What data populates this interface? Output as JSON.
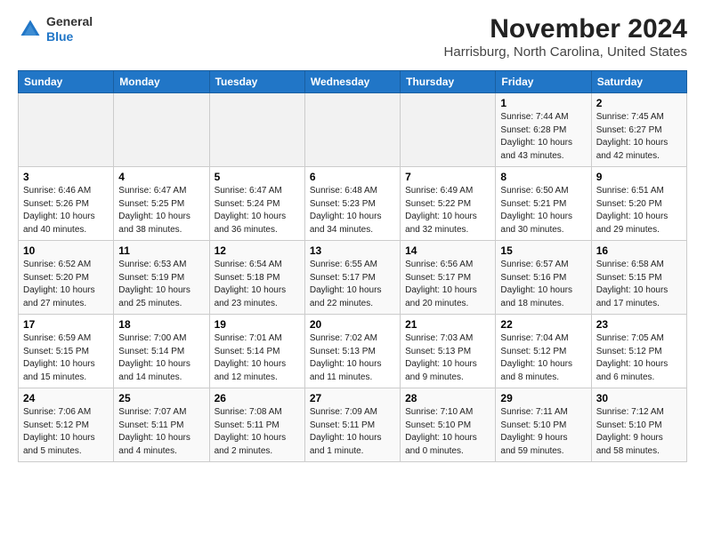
{
  "header": {
    "logo_line1": "General",
    "logo_line2": "Blue",
    "month_year": "November 2024",
    "location": "Harrisburg, North Carolina, United States"
  },
  "weekdays": [
    "Sunday",
    "Monday",
    "Tuesday",
    "Wednesday",
    "Thursday",
    "Friday",
    "Saturday"
  ],
  "weeks": [
    [
      {
        "day": "",
        "info": ""
      },
      {
        "day": "",
        "info": ""
      },
      {
        "day": "",
        "info": ""
      },
      {
        "day": "",
        "info": ""
      },
      {
        "day": "",
        "info": ""
      },
      {
        "day": "1",
        "info": "Sunrise: 7:44 AM\nSunset: 6:28 PM\nDaylight: 10 hours\nand 43 minutes."
      },
      {
        "day": "2",
        "info": "Sunrise: 7:45 AM\nSunset: 6:27 PM\nDaylight: 10 hours\nand 42 minutes."
      }
    ],
    [
      {
        "day": "3",
        "info": "Sunrise: 6:46 AM\nSunset: 5:26 PM\nDaylight: 10 hours\nand 40 minutes."
      },
      {
        "day": "4",
        "info": "Sunrise: 6:47 AM\nSunset: 5:25 PM\nDaylight: 10 hours\nand 38 minutes."
      },
      {
        "day": "5",
        "info": "Sunrise: 6:47 AM\nSunset: 5:24 PM\nDaylight: 10 hours\nand 36 minutes."
      },
      {
        "day": "6",
        "info": "Sunrise: 6:48 AM\nSunset: 5:23 PM\nDaylight: 10 hours\nand 34 minutes."
      },
      {
        "day": "7",
        "info": "Sunrise: 6:49 AM\nSunset: 5:22 PM\nDaylight: 10 hours\nand 32 minutes."
      },
      {
        "day": "8",
        "info": "Sunrise: 6:50 AM\nSunset: 5:21 PM\nDaylight: 10 hours\nand 30 minutes."
      },
      {
        "day": "9",
        "info": "Sunrise: 6:51 AM\nSunset: 5:20 PM\nDaylight: 10 hours\nand 29 minutes."
      }
    ],
    [
      {
        "day": "10",
        "info": "Sunrise: 6:52 AM\nSunset: 5:20 PM\nDaylight: 10 hours\nand 27 minutes."
      },
      {
        "day": "11",
        "info": "Sunrise: 6:53 AM\nSunset: 5:19 PM\nDaylight: 10 hours\nand 25 minutes."
      },
      {
        "day": "12",
        "info": "Sunrise: 6:54 AM\nSunset: 5:18 PM\nDaylight: 10 hours\nand 23 minutes."
      },
      {
        "day": "13",
        "info": "Sunrise: 6:55 AM\nSunset: 5:17 PM\nDaylight: 10 hours\nand 22 minutes."
      },
      {
        "day": "14",
        "info": "Sunrise: 6:56 AM\nSunset: 5:17 PM\nDaylight: 10 hours\nand 20 minutes."
      },
      {
        "day": "15",
        "info": "Sunrise: 6:57 AM\nSunset: 5:16 PM\nDaylight: 10 hours\nand 18 minutes."
      },
      {
        "day": "16",
        "info": "Sunrise: 6:58 AM\nSunset: 5:15 PM\nDaylight: 10 hours\nand 17 minutes."
      }
    ],
    [
      {
        "day": "17",
        "info": "Sunrise: 6:59 AM\nSunset: 5:15 PM\nDaylight: 10 hours\nand 15 minutes."
      },
      {
        "day": "18",
        "info": "Sunrise: 7:00 AM\nSunset: 5:14 PM\nDaylight: 10 hours\nand 14 minutes."
      },
      {
        "day": "19",
        "info": "Sunrise: 7:01 AM\nSunset: 5:14 PM\nDaylight: 10 hours\nand 12 minutes."
      },
      {
        "day": "20",
        "info": "Sunrise: 7:02 AM\nSunset: 5:13 PM\nDaylight: 10 hours\nand 11 minutes."
      },
      {
        "day": "21",
        "info": "Sunrise: 7:03 AM\nSunset: 5:13 PM\nDaylight: 10 hours\nand 9 minutes."
      },
      {
        "day": "22",
        "info": "Sunrise: 7:04 AM\nSunset: 5:12 PM\nDaylight: 10 hours\nand 8 minutes."
      },
      {
        "day": "23",
        "info": "Sunrise: 7:05 AM\nSunset: 5:12 PM\nDaylight: 10 hours\nand 6 minutes."
      }
    ],
    [
      {
        "day": "24",
        "info": "Sunrise: 7:06 AM\nSunset: 5:12 PM\nDaylight: 10 hours\nand 5 minutes."
      },
      {
        "day": "25",
        "info": "Sunrise: 7:07 AM\nSunset: 5:11 PM\nDaylight: 10 hours\nand 4 minutes."
      },
      {
        "day": "26",
        "info": "Sunrise: 7:08 AM\nSunset: 5:11 PM\nDaylight: 10 hours\nand 2 minutes."
      },
      {
        "day": "27",
        "info": "Sunrise: 7:09 AM\nSunset: 5:11 PM\nDaylight: 10 hours\nand 1 minute."
      },
      {
        "day": "28",
        "info": "Sunrise: 7:10 AM\nSunset: 5:10 PM\nDaylight: 10 hours\nand 0 minutes."
      },
      {
        "day": "29",
        "info": "Sunrise: 7:11 AM\nSunset: 5:10 PM\nDaylight: 9 hours\nand 59 minutes."
      },
      {
        "day": "30",
        "info": "Sunrise: 7:12 AM\nSunset: 5:10 PM\nDaylight: 9 hours\nand 58 minutes."
      }
    ]
  ]
}
